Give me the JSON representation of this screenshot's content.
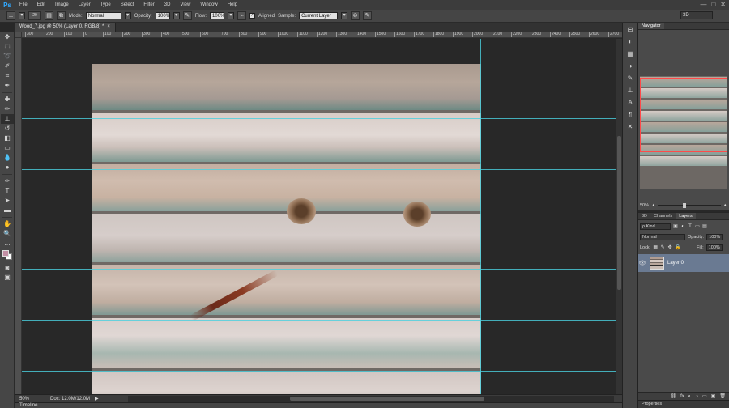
{
  "app": {
    "logo": "Ps"
  },
  "menu": [
    "File",
    "Edit",
    "Image",
    "Layer",
    "Type",
    "Select",
    "Filter",
    "3D",
    "View",
    "Window",
    "Help"
  ],
  "window_controls": {
    "minimize": "—",
    "maximize": "□",
    "close": "✕"
  },
  "options": {
    "mode_label": "Mode:",
    "mode_value": "Normal",
    "opacity_label": "Opacity:",
    "opacity_value": "100%",
    "flow_label": "Flow:",
    "flow_value": "100%",
    "aligned_label": "Aligned",
    "aligned_checked": "✓",
    "sample_label": "Sample:",
    "sample_value": "Current Layer",
    "workspace_value": "3D",
    "brush_size": "20"
  },
  "document": {
    "tab_title": "Wood_7.jpg @ 50% (Layer 0, RGB/8) *",
    "tab_close": "×"
  },
  "ruler_labels": [
    "300",
    "200",
    "100",
    "0",
    "100",
    "200",
    "300",
    "400",
    "500",
    "600",
    "700",
    "800",
    "900",
    "1000",
    "1100",
    "1200",
    "1300",
    "1400",
    "1500",
    "1600",
    "1700",
    "1800",
    "1900",
    "2000",
    "2100",
    "2200",
    "2300",
    "2400",
    "2500",
    "2600",
    "2700"
  ],
  "status": {
    "zoom": "50%",
    "doc": "Doc: 12.0M/12.0M",
    "arrow": "▶"
  },
  "timeline": {
    "label": "Timeline"
  },
  "navigator": {
    "tab": "Navigator",
    "zoom": "50%"
  },
  "layers": {
    "tabs": [
      "3D",
      "Channels",
      "Layers"
    ],
    "kind_label": "ρ Kind",
    "blend_mode": "Normal",
    "opacity_label": "Opacity:",
    "opacity_value": "100%",
    "lock_label": "Lock:",
    "fill_label": "Fill:",
    "fill_value": "100%",
    "layer_name": "Layer 0",
    "footer_icons": [
      "⛓",
      "fx",
      "◐",
      "◑",
      "▭",
      "▣",
      "🗑"
    ]
  },
  "properties": {
    "tab": "Properties"
  },
  "colors": {
    "foreground": "#c28fa4",
    "background": "#ffffff",
    "guide": "#4ad0df",
    "selected_layer": "#6a7a92"
  }
}
